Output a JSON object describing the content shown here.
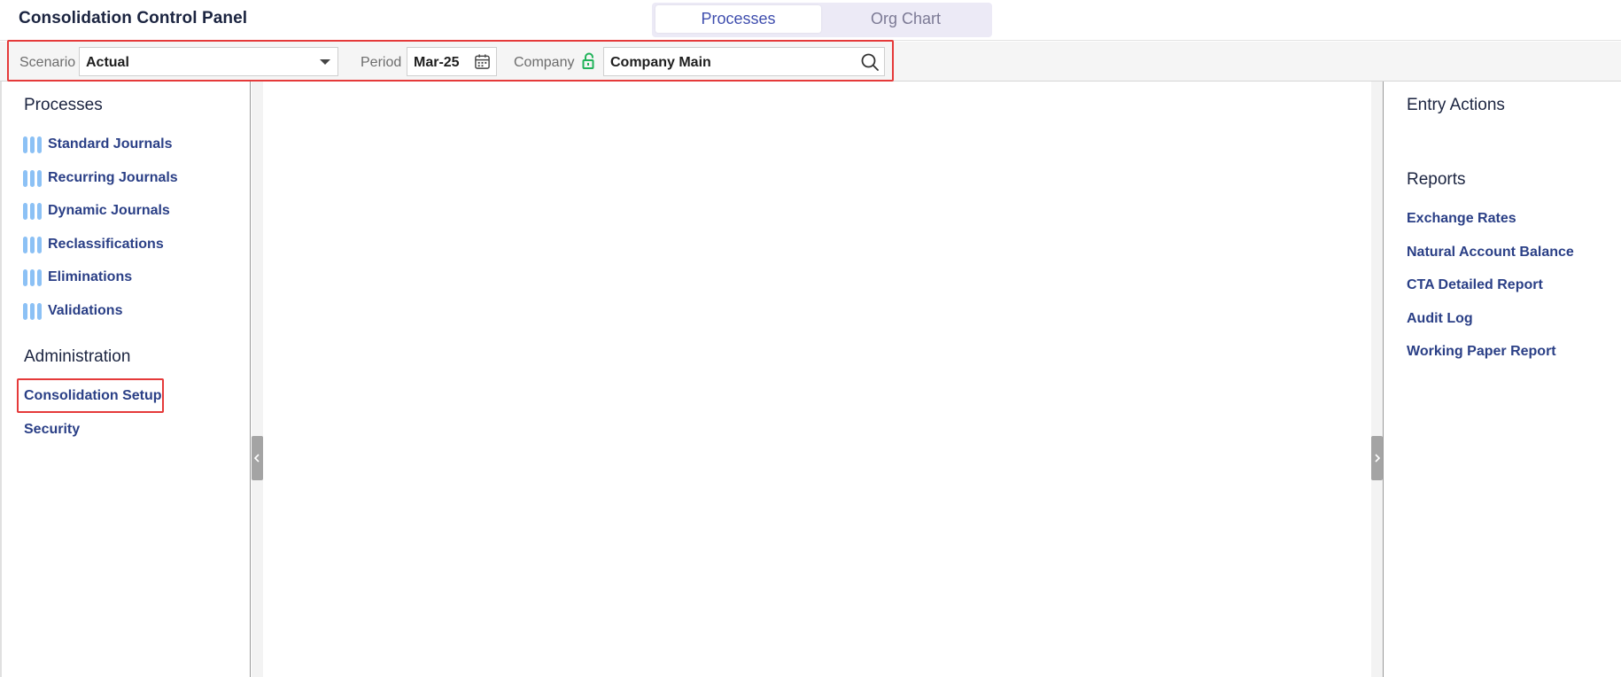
{
  "header": {
    "title": "Consolidation Control Panel",
    "tabs": [
      {
        "label": "Processes",
        "active": true
      },
      {
        "label": "Org Chart",
        "active": false
      }
    ]
  },
  "filters": {
    "scenario_label": "Scenario",
    "scenario_value": "Actual",
    "period_label": "Period",
    "period_value": "Mar-25",
    "company_label": "Company",
    "company_value": "Company Main"
  },
  "left_panel": {
    "processes_title": "Processes",
    "processes": [
      {
        "label": "Standard Journals"
      },
      {
        "label": "Recurring Journals"
      },
      {
        "label": "Dynamic Journals"
      },
      {
        "label": "Reclassifications"
      },
      {
        "label": "Eliminations"
      },
      {
        "label": "Validations"
      }
    ],
    "administration_title": "Administration",
    "administration": [
      {
        "label": "Consolidation Setup"
      },
      {
        "label": "Security"
      }
    ]
  },
  "right_panel": {
    "entry_actions_title": "Entry Actions",
    "reports_title": "Reports",
    "reports": [
      {
        "label": "Exchange Rates"
      },
      {
        "label": "Natural Account Balance"
      },
      {
        "label": "CTA Detailed Report"
      },
      {
        "label": "Audit Log"
      },
      {
        "label": "Working Paper Report"
      }
    ]
  },
  "colors": {
    "link": "#2a3f86",
    "active_tab_text": "#3f4eae",
    "process_bar": "#8cc1f5",
    "lock_icon": "#21b35a",
    "highlight": "#e53a3a"
  },
  "icons": {
    "scenario_dropdown": "chevron-down-icon",
    "period_picker": "calendar-icon",
    "company_lock": "unlock-icon",
    "company_search": "search-icon",
    "process_item": "bars-icon",
    "collapse_left": "chevron-left-icon",
    "collapse_right": "chevron-right-icon"
  }
}
